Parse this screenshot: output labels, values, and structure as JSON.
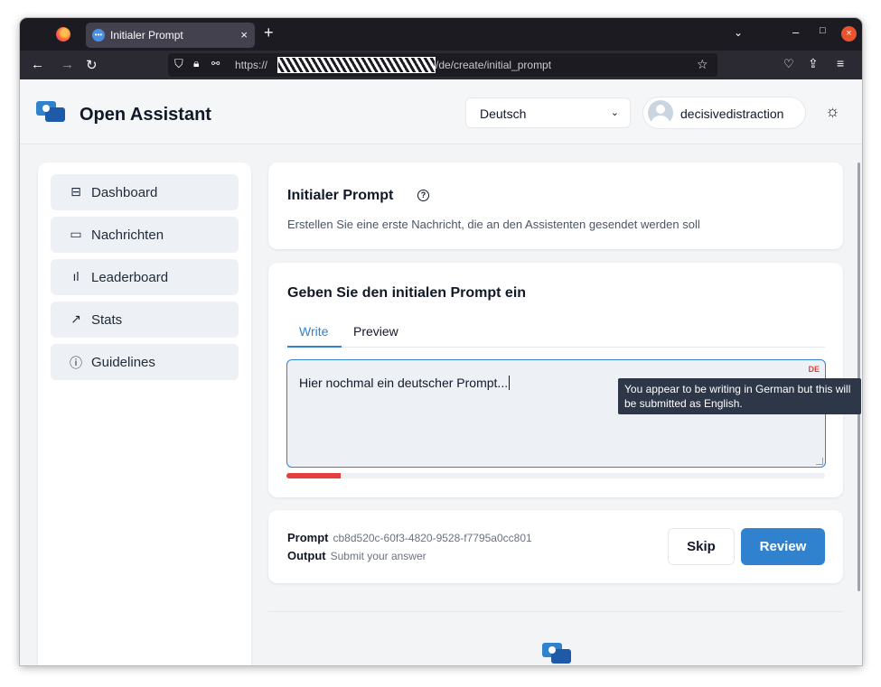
{
  "browser": {
    "tab_title": "Initialer Prompt",
    "tab_close": "×",
    "new_tab": "+",
    "list_tabs": "⌄",
    "url_scheme": "https://",
    "url_path": "/de/create/initial_prompt",
    "window_minimize": "–",
    "window_maximize": "□",
    "window_close": "×"
  },
  "header": {
    "app_title": "Open Assistant",
    "language": "Deutsch",
    "username": "decisivedistraction"
  },
  "sidebar": {
    "items": [
      {
        "label": "Dashboard",
        "icon": "layout-icon"
      },
      {
        "label": "Nachrichten",
        "icon": "message-icon"
      },
      {
        "label": "Leaderboard",
        "icon": "bar-chart-icon"
      },
      {
        "label": "Stats",
        "icon": "trending-up-icon"
      },
      {
        "label": "Guidelines",
        "icon": "help-circle-icon"
      }
    ]
  },
  "task_card": {
    "title": "Initialer Prompt",
    "description": "Erstellen Sie eine erste Nachricht, die an den Assistenten gesendet werden soll"
  },
  "prompt_card": {
    "heading": "Geben Sie den initialen Prompt ein",
    "tab_write": "Write",
    "tab_preview": "Preview",
    "textarea_value": "Hier nochmal ein deutscher Prompt...",
    "language_badge": "DE",
    "progress_fraction": 0.1,
    "tooltip": "You appear to be writing in German but this will be submitted as English."
  },
  "footer_card": {
    "prompt_label": "Prompt",
    "prompt_id": "cb8d520c-60f3-4820-9528-f7795a0cc801",
    "output_label": "Output",
    "output_value": "Submit your answer",
    "skip_label": "Skip",
    "review_label": "Review"
  },
  "colors": {
    "accent": "#3182ce",
    "error": "#e53e3e",
    "background": "#f3f4f6"
  }
}
